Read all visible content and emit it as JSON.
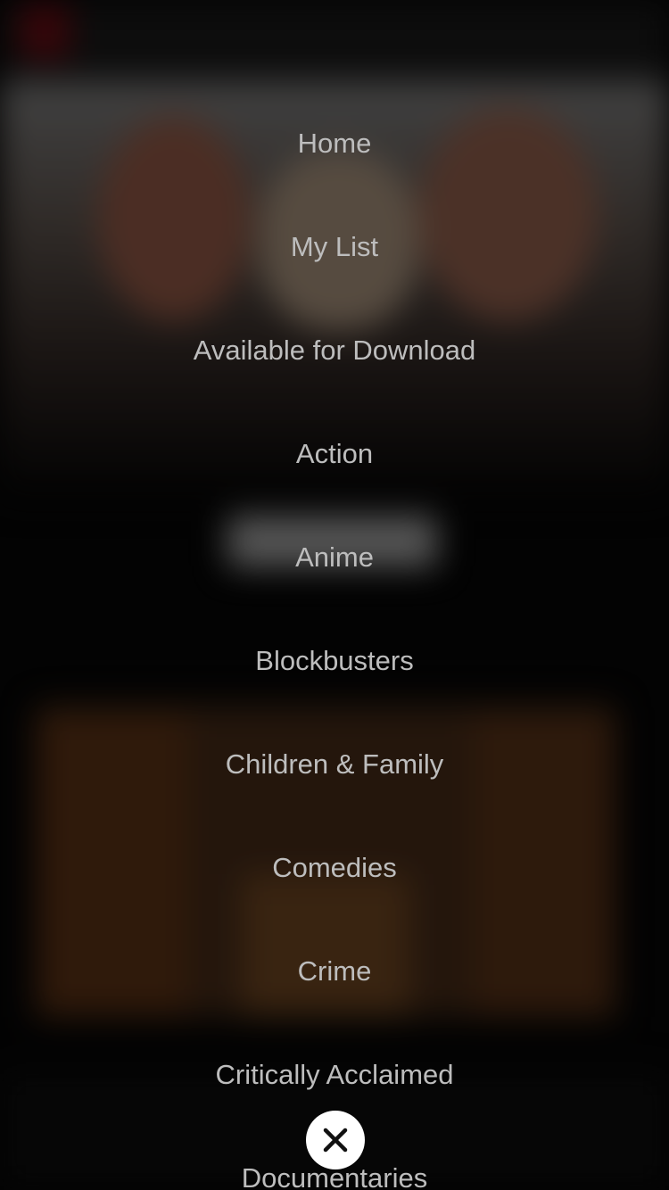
{
  "menu": {
    "items": [
      {
        "label": "Home"
      },
      {
        "label": "My List"
      },
      {
        "label": "Available for Download"
      },
      {
        "label": "Action"
      },
      {
        "label": "Anime"
      },
      {
        "label": "Blockbusters"
      },
      {
        "label": "Children & Family"
      },
      {
        "label": "Comedies"
      },
      {
        "label": "Crime"
      },
      {
        "label": "Critically Acclaimed"
      },
      {
        "label": "Documentaries"
      }
    ]
  },
  "close_button": {
    "icon": "close-icon",
    "background": "#ffffff",
    "icon_color": "#111111"
  },
  "colors": {
    "menu_text": "#bdbdbd",
    "overlay": "#000000"
  }
}
